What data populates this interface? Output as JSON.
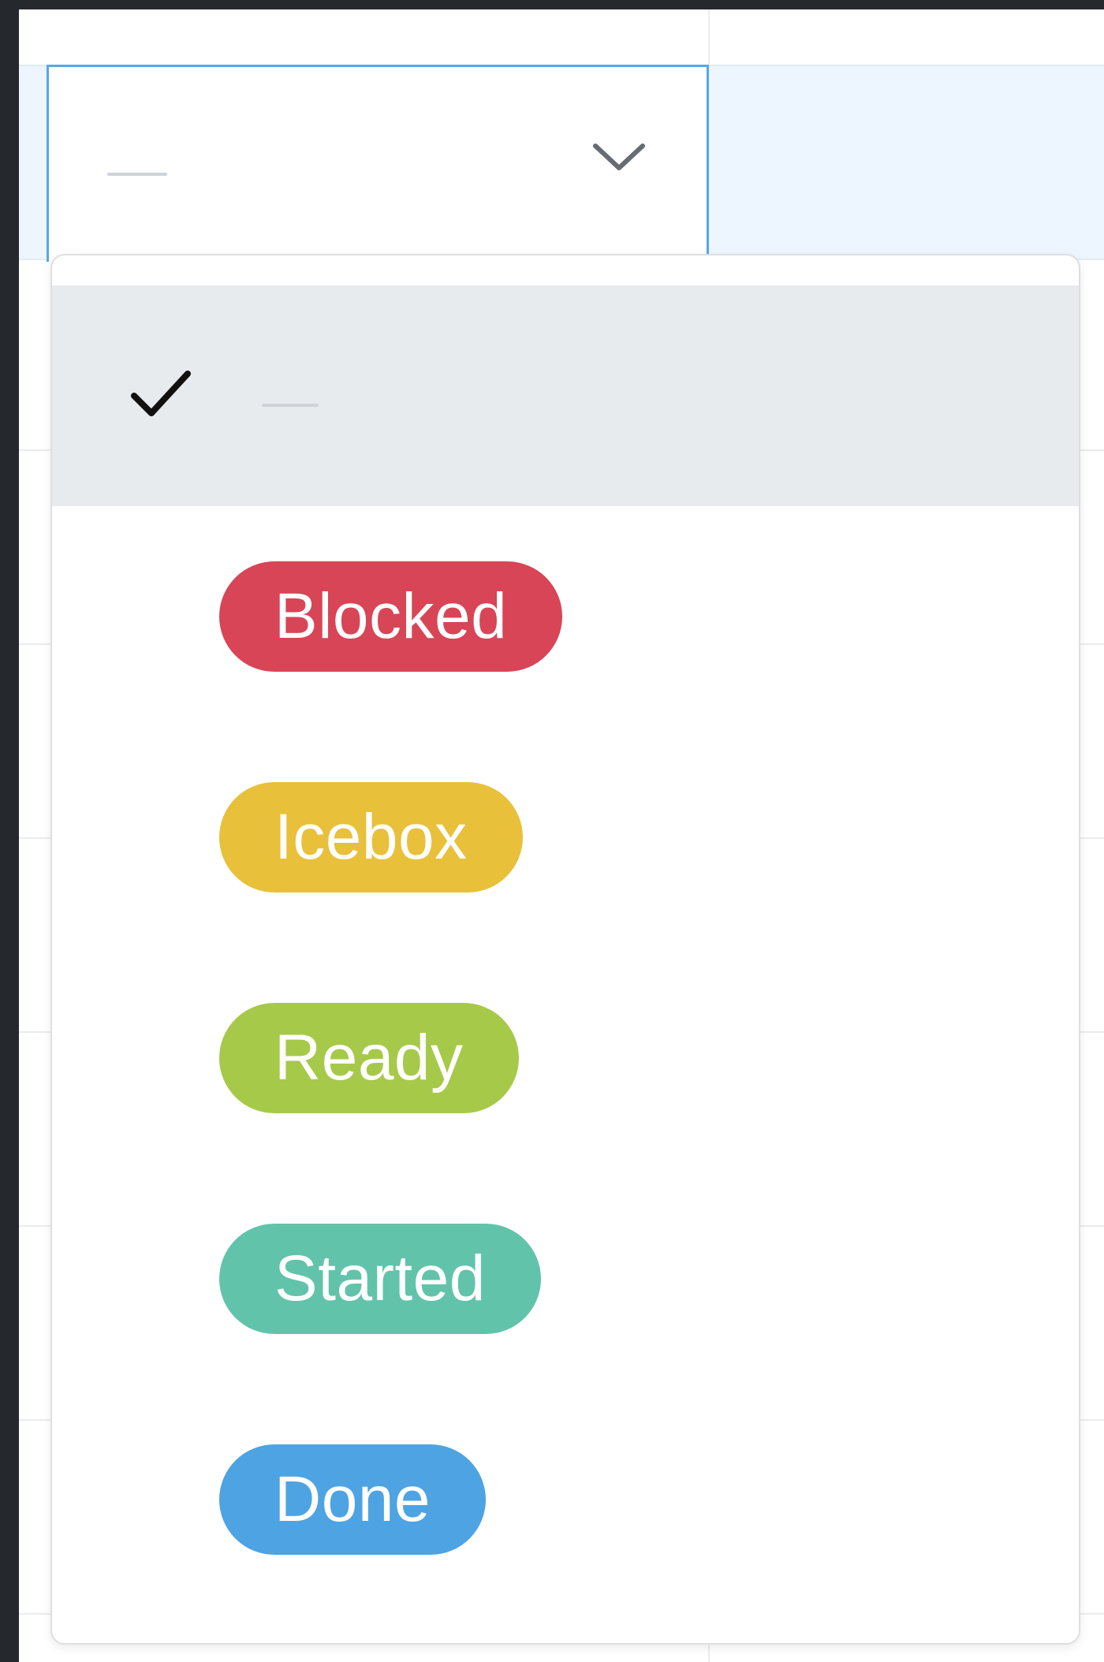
{
  "status_field": {
    "selected_value": "—"
  },
  "dropdown": {
    "options": [
      {
        "label": "—",
        "selected": true,
        "color": ""
      },
      {
        "label": "Blocked",
        "selected": false,
        "color": "#d84556"
      },
      {
        "label": "Icebox",
        "selected": false,
        "color": "#e8c03a"
      },
      {
        "label": "Ready",
        "selected": false,
        "color": "#a7c94a"
      },
      {
        "label": "Started",
        "selected": false,
        "color": "#62c3ab"
      },
      {
        "label": "Done",
        "selected": false,
        "color": "#4ea3e2"
      }
    ]
  }
}
